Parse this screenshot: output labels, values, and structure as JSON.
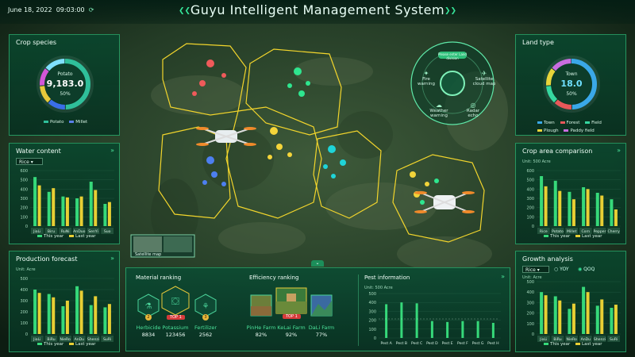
{
  "header": {
    "date": "June 18, 2022",
    "time": "09:03:00",
    "title": "Guyu Intelligent Management System",
    "refresh_icon": "refresh-icon"
  },
  "crop_species": {
    "title": "Crop species",
    "center_label": "Potato",
    "center_value": "9,183.0",
    "center_percent": "50%",
    "legend": [
      {
        "label": "Potato",
        "color": "#2fbf9a"
      },
      {
        "label": "Millet",
        "color": "#5a7fe8"
      }
    ],
    "ring_colors": [
      "#2fbf9a",
      "#3a6ee8",
      "#e8c93a",
      "#d256d8",
      "#7fe0ff"
    ],
    "share": 0.5
  },
  "land_type": {
    "title": "Land type",
    "center_label": "Town",
    "center_value": "18.0",
    "center_percent": "50%",
    "legend": [
      {
        "label": "Town",
        "color": "#3aa8e8"
      },
      {
        "label": "Forest",
        "color": "#e8585a"
      },
      {
        "label": "Field",
        "color": "#36d7a0"
      },
      {
        "label": "Plough",
        "color": "#e8d43a"
      },
      {
        "label": "Paddy field",
        "color": "#c96de0"
      }
    ],
    "share": 0.5
  },
  "water_content": {
    "title": "Water content",
    "select": "Rice",
    "more_icon": "double-chevron-icon",
    "legend": [
      "This year",
      "Last year"
    ]
  },
  "production_forecast": {
    "title": "Production forecast",
    "unit": "Unit: Acre",
    "legend": [
      "This year",
      "Last year"
    ]
  },
  "crop_area": {
    "title": "Crop area comparison",
    "unit": "Unit: 500 Acre",
    "legend": [
      "This year",
      "Last year"
    ]
  },
  "growth_analysis": {
    "title": "Growth analysis",
    "select": "Rice",
    "yoy": "YOY",
    "qoq": "QOQ",
    "unit": "Unit: Acre",
    "legend": [
      "This year",
      "Last year"
    ]
  },
  "map": {
    "satellite_label": "Satellite map",
    "hud": {
      "center_label": "Please enter Land division",
      "items": [
        "Fire warning",
        "Satellite cloud map",
        "Weather warning",
        "Radar echo"
      ]
    }
  },
  "material_ranking": {
    "title": "Material ranking",
    "items": [
      {
        "rank": "2",
        "name": "Herbicide",
        "value": "8834"
      },
      {
        "rank": "TOP 1",
        "name": "Potassium",
        "value": "123456"
      },
      {
        "rank": "3",
        "name": "Fertilizer",
        "value": "2562"
      }
    ]
  },
  "efficiency_ranking": {
    "title": "Efficiency ranking",
    "items": [
      {
        "rank": "",
        "name": "PinHe Farm",
        "value": "82%"
      },
      {
        "rank": "TOP 1",
        "name": "KeLai Farm",
        "value": "92%"
      },
      {
        "rank": "",
        "name": "DaLi Farm",
        "value": "77%"
      }
    ]
  },
  "pest": {
    "title": "Pest information",
    "unit": "Unit: 500 Acre"
  },
  "chart_data": [
    {
      "id": "water",
      "type": "bar",
      "categories": [
        "JiaLi",
        "Biru",
        "RuNi",
        "AnDuo",
        "SenYi",
        "Suo"
      ],
      "ylim": [
        0,
        600
      ],
      "yticks": [
        0,
        100,
        200,
        300,
        400,
        500,
        600
      ],
      "series": [
        {
          "name": "This year",
          "color": "#36d97a",
          "values": [
            530,
            370,
            320,
            300,
            480,
            240
          ]
        },
        {
          "name": "Last year",
          "color": "#e8cf34",
          "values": [
            440,
            410,
            310,
            320,
            390,
            260
          ]
        }
      ]
    },
    {
      "id": "forecast",
      "type": "bar",
      "categories": [
        "JiaLi",
        "BiRu",
        "NieRo",
        "AnDu",
        "Shenzi",
        "SuRi"
      ],
      "ylim": [
        0,
        500
      ],
      "yticks": [
        0,
        100,
        200,
        300,
        400,
        500
      ],
      "series": [
        {
          "name": "This year",
          "color": "#36d97a",
          "values": [
            400,
            360,
            250,
            430,
            260,
            240
          ]
        },
        {
          "name": "Last year",
          "color": "#e8cf34",
          "values": [
            370,
            330,
            300,
            390,
            340,
            270
          ]
        }
      ]
    },
    {
      "id": "croparea",
      "type": "bar",
      "categories": [
        "Rice",
        "Potato",
        "Millet",
        "Corn",
        "Pepper",
        "Cherry"
      ],
      "ylim": [
        0,
        600
      ],
      "yticks": [
        0,
        100,
        200,
        300,
        400,
        500,
        600
      ],
      "series": [
        {
          "name": "This year",
          "color": "#36d97a",
          "values": [
            540,
            490,
            370,
            420,
            360,
            290
          ]
        },
        {
          "name": "Last year",
          "color": "#e8cf34",
          "values": [
            430,
            380,
            290,
            400,
            330,
            180
          ]
        }
      ]
    },
    {
      "id": "growth",
      "type": "bar",
      "categories": [
        "JiaLi",
        "BiRu",
        "NieRo",
        "AnDu",
        "Shenzi",
        "SuRi"
      ],
      "ylim": [
        0,
        500
      ],
      "yticks": [
        0,
        100,
        200,
        300,
        400,
        500
      ],
      "series": [
        {
          "name": "This year",
          "color": "#36d97a",
          "values": [
            400,
            360,
            240,
            450,
            270,
            250
          ]
        },
        {
          "name": "Last year",
          "color": "#e8cf34",
          "values": [
            370,
            320,
            290,
            400,
            330,
            280
          ]
        }
      ]
    },
    {
      "id": "pest",
      "type": "bar",
      "categories": [
        "Pest A",
        "Pest B",
        "Pest C",
        "Pest D",
        "Pest E",
        "Pest F",
        "Pest G",
        "Pest H"
      ],
      "ylim": [
        0,
        500
      ],
      "yticks": [
        0,
        100,
        200,
        300,
        400,
        500
      ],
      "series": [
        {
          "name": "Pest",
          "color": "#36d97a",
          "values": [
            380,
            400,
            390,
            190,
            180,
            190,
            190,
            170
          ]
        }
      ]
    }
  ]
}
